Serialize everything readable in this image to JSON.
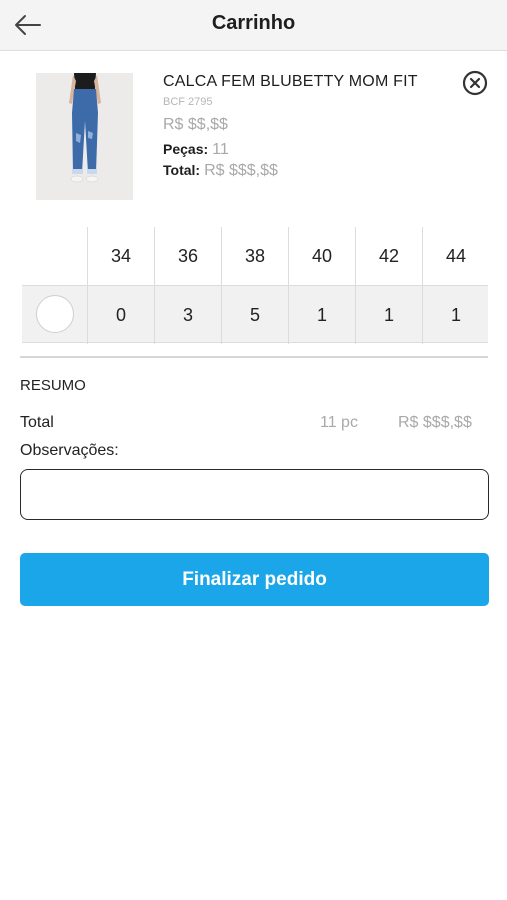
{
  "header": {
    "title": "Carrinho",
    "back_icon": "arrow-left-icon"
  },
  "product": {
    "name": "CALCA FEM BLUBETTY MOM FIT",
    "code": "BCF 2795",
    "price": "R$ $$,$$",
    "pecas_label": "Peças:",
    "pecas_value": "11",
    "total_label": "Total:",
    "total_value": "R$ $$$,$$",
    "image": "product-photo-jeans",
    "remove_icon": "close-circle-icon"
  },
  "sizes": {
    "headers": [
      "34",
      "36",
      "38",
      "40",
      "42",
      "44"
    ],
    "quantities": [
      "0",
      "3",
      "5",
      "1",
      "1",
      "1"
    ]
  },
  "summary": {
    "title": "RESUMO",
    "total_label": "Total",
    "total_pcs": "11 pc",
    "total_value": "R$ $$$,$$",
    "observations_label": "Observações:",
    "observations_value": ""
  },
  "actions": {
    "finalize_label": "Finalizar pedido"
  },
  "colors": {
    "accent": "#1ba6ea",
    "header_bg": "#f4f4f4",
    "muted_text": "#a9a9a9"
  }
}
